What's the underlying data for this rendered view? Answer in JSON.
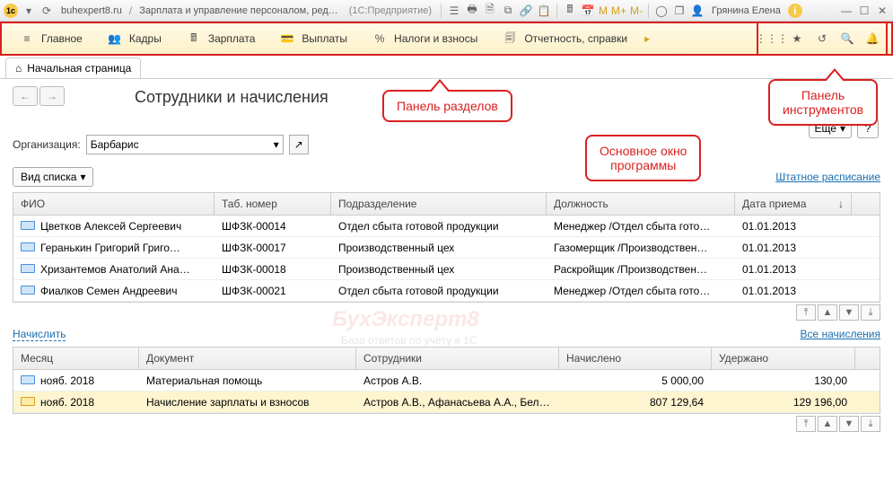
{
  "titlebar": {
    "site": "buhexpert8.ru",
    "title": "Зарплата и управление персоналом, ред…",
    "subtitle": "(1С:Предприятие)",
    "user": "Грянина Елена",
    "m": "M",
    "mp": "M+",
    "mm": "M-"
  },
  "sections": [
    {
      "label": "Главное",
      "icon": "menu"
    },
    {
      "label": "Кадры",
      "icon": "people"
    },
    {
      "label": "Зарплата",
      "icon": "calc"
    },
    {
      "label": "Выплаты",
      "icon": "wallet"
    },
    {
      "label": "Налоги и взносы",
      "icon": "percent"
    },
    {
      "label": "Отчетность, справки",
      "icon": "doc"
    }
  ],
  "nav_tab": "Начальная страница",
  "page_title": "Сотрудники и начисления",
  "org_label": "Организация:",
  "org_value": "Барбарис",
  "more_label": "Еще",
  "view_label": "Вид списка",
  "staff_link": "Штатное расписание",
  "accrue_link": "Начислить",
  "all_accruals_link": "Все начисления",
  "callouts": {
    "sections": "Панель разделов",
    "main": "Основное окно\nпрограммы",
    "tools": "Панель\nинструментов"
  },
  "table1": {
    "headers": {
      "fio": "ФИО",
      "tab": "Таб. номер",
      "pod": "Подразделение",
      "dol": "Должность",
      "date": "Дата приема"
    },
    "rows": [
      {
        "fio": "Цветков Алексей Сергеевич",
        "tab": "ШФЗК-00014",
        "pod": "Отдел сбыта готовой продукции",
        "dol": "Менеджер /Отдел сбыта гото…",
        "date": "01.01.2013"
      },
      {
        "fio": "Геранькин Григорий Григо…",
        "tab": "ШФЗК-00017",
        "pod": "Производственный цех",
        "dol": "Газомерщик /Производствен…",
        "date": "01.01.2013"
      },
      {
        "fio": "Хризантемов Анатолий Ана…",
        "tab": "ШФЗК-00018",
        "pod": "Производственный цех",
        "dol": "Раскройщик /Производствен…",
        "date": "01.01.2013"
      },
      {
        "fio": "Фиалков Семен Андреевич",
        "tab": "ШФЗК-00021",
        "pod": "Отдел сбыта готовой продукции",
        "dol": "Менеджер /Отдел сбыта гото…",
        "date": "01.01.2013"
      }
    ]
  },
  "table2": {
    "headers": {
      "month": "Месяц",
      "doc": "Документ",
      "emp": "Сотрудники",
      "acc": "Начислено",
      "ded": "Удержано"
    },
    "rows": [
      {
        "month": "нояб. 2018",
        "doc": "Материальная помощь",
        "emp": "Астров А.В.",
        "acc": "5 000,00",
        "ded": "130,00",
        "sel": false,
        "icon": "green"
      },
      {
        "month": "нояб. 2018",
        "doc": "Начисление зарплаты и взносов",
        "emp": "Астров А.В., Афанасьева А.А., Белобокин …",
        "acc": "807 129,64",
        "ded": "129 196,00",
        "sel": true,
        "icon": "gold"
      }
    ]
  },
  "watermark": {
    "main": "БухЭксперт8",
    "sub": "База ответов по учёту в 1С"
  }
}
